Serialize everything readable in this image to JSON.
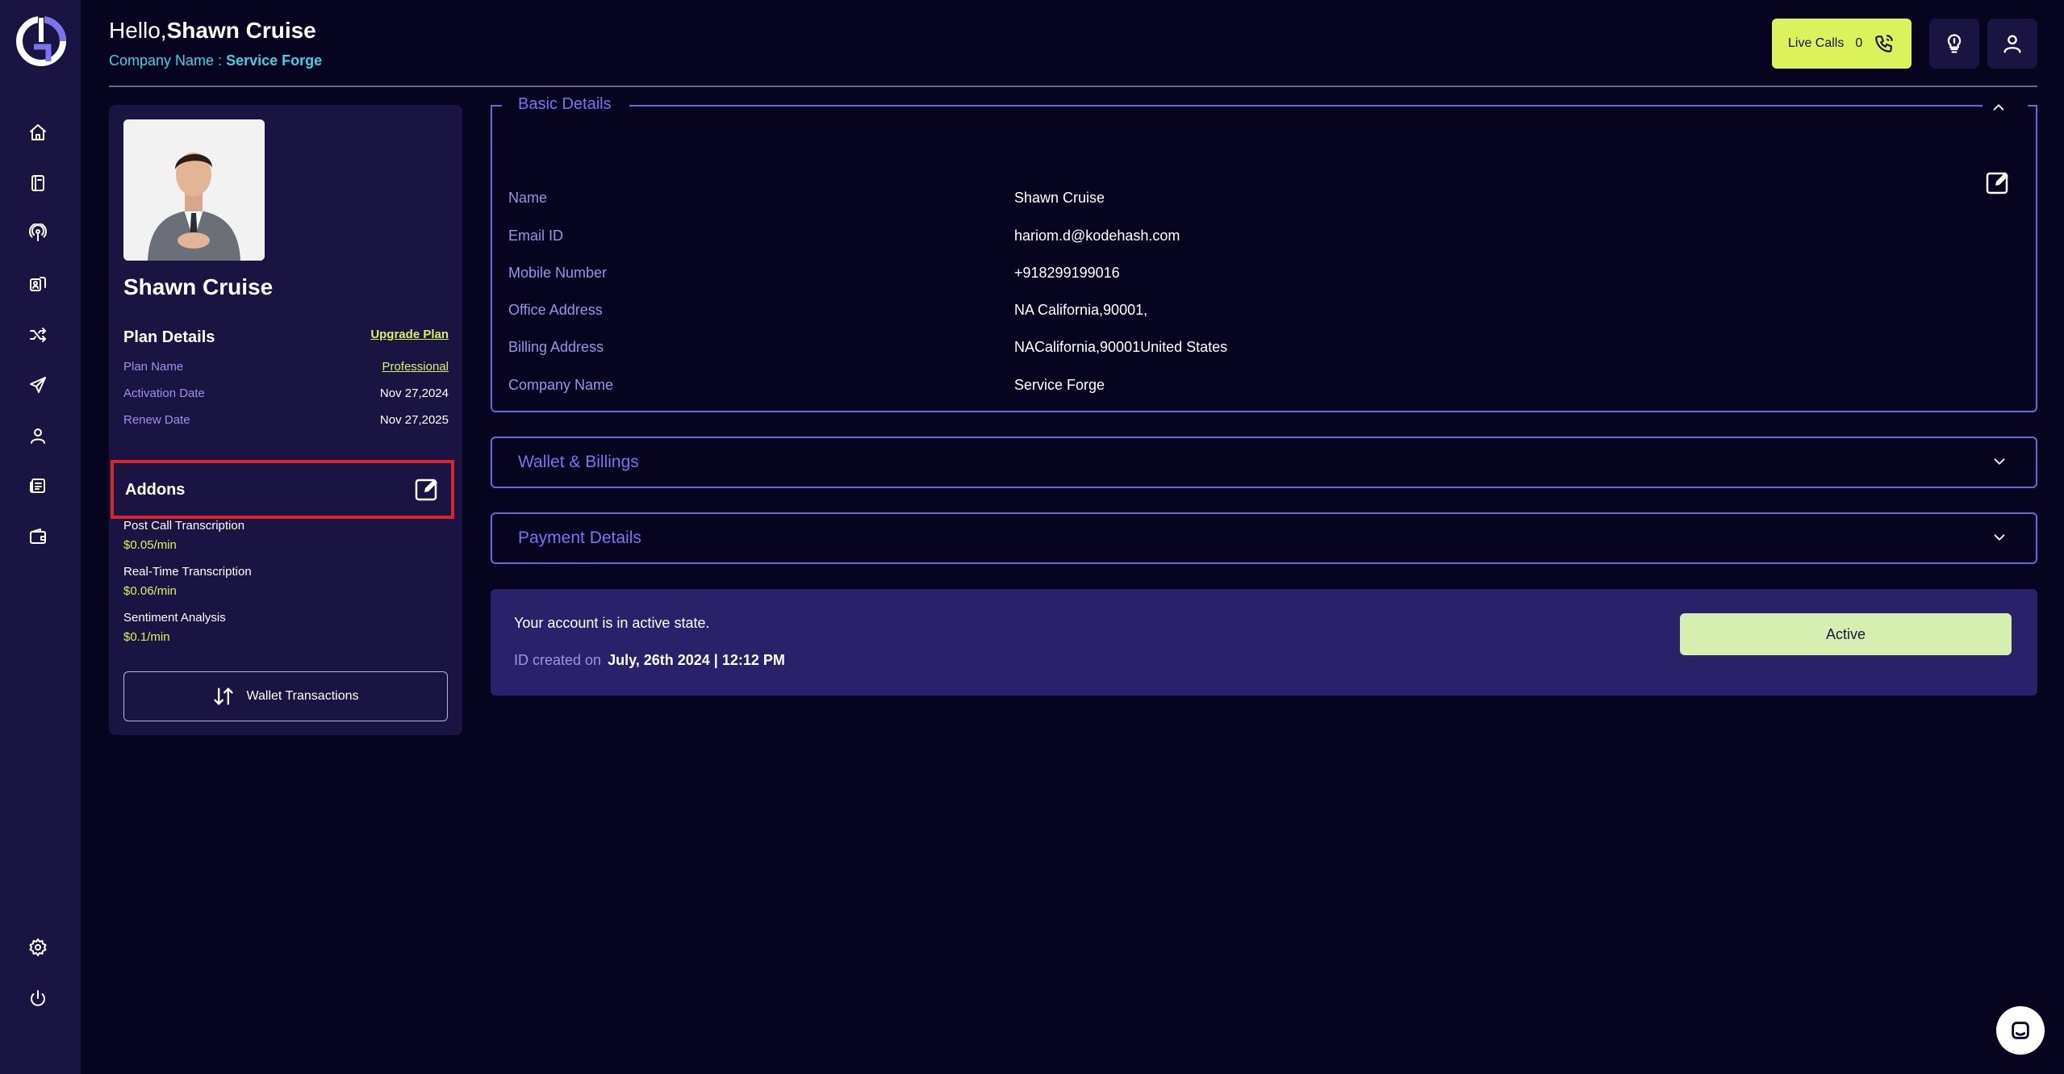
{
  "header": {
    "greeting_prefix": "Hello,",
    "user_name": "Shawn Cruise",
    "company_label": "Company Name :",
    "company_name": "Service Forge",
    "live_calls_label": "Live Calls",
    "live_calls_count": "0"
  },
  "sidebar": {
    "items": [
      {
        "icon": "home-icon"
      },
      {
        "icon": "book-icon"
      },
      {
        "icon": "podcast-icon"
      },
      {
        "icon": "contacts-icon"
      },
      {
        "icon": "shuffle-icon"
      },
      {
        "icon": "send-icon"
      },
      {
        "icon": "user-icon"
      },
      {
        "icon": "news-icon"
      },
      {
        "icon": "wallet-icon"
      }
    ],
    "bottom": [
      {
        "icon": "gear-icon"
      },
      {
        "icon": "power-icon"
      }
    ]
  },
  "profile": {
    "name": "Shawn Cruise",
    "plan_title": "Plan Details",
    "upgrade_label": "Upgrade Plan",
    "plan": [
      {
        "label": "Plan Name",
        "value": "Professional"
      },
      {
        "label": "Activation Date",
        "value": "Nov 27,2024"
      },
      {
        "label": "Renew Date",
        "value": "Nov 27,2025"
      }
    ],
    "addons_title": "Addons",
    "addons": [
      {
        "name": "Post Call Transcription",
        "price": "$0.05/min"
      },
      {
        "name": "Real-Time Transcription",
        "price": "$0.06/min"
      },
      {
        "name": "Sentiment Analysis",
        "price": "$0.1/min"
      }
    ],
    "wallet_button": "Wallet Transactions"
  },
  "basic_details": {
    "title": "Basic Details",
    "rows": [
      {
        "label": "Name",
        "value": "Shawn Cruise"
      },
      {
        "label": "Email ID",
        "value": "hariom.d@kodehash.com"
      },
      {
        "label": "Mobile Number",
        "value": "+918299199016"
      },
      {
        "label": "Office Address",
        "value": "NA California,90001,"
      },
      {
        "label": "Billing Address",
        "value": "NACalifornia,90001United States"
      },
      {
        "label": "Company Name",
        "value": "Service Forge"
      }
    ]
  },
  "accordions": {
    "wallet": "Wallet & Billings",
    "payment": "Payment Details"
  },
  "status": {
    "message": "Your account is in active state.",
    "created_label": "ID created on",
    "created_value": "July, 26th 2024 | 12:12 PM",
    "button": "Active"
  },
  "colors": {
    "background": "#06041f",
    "panel": "#1a1442",
    "accent_yellow": "#dcf25a",
    "accent_purple": "#7b73f0",
    "cyan": "#3dd2e6",
    "highlight_red": "#d9252b"
  }
}
